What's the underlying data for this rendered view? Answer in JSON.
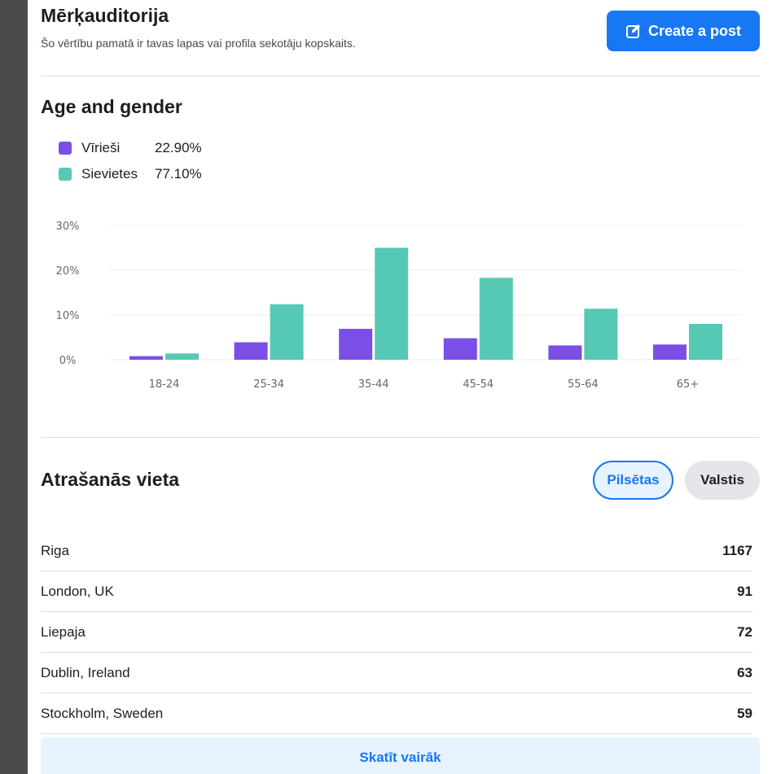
{
  "header": {
    "title": "Mērķauditorija",
    "subtitle": "Šo vērtību pamatā ir tavas lapas vai profila sekotāju kopskaits.",
    "create_label": "Create a post",
    "create_icon": "edit-icon"
  },
  "age_gender": {
    "title": "Age and gender",
    "legend": [
      {
        "name": "Vīrieši",
        "value": "22.90%",
        "color": "#7b4fe6"
      },
      {
        "name": "Sievietes",
        "value": "77.10%",
        "color": "#56c9b5"
      }
    ]
  },
  "chart_data": {
    "type": "bar",
    "categories": [
      "18-24",
      "25-34",
      "35-44",
      "45-54",
      "55-64",
      "65+"
    ],
    "series": [
      {
        "name": "Vīrieši",
        "values": [
          0.8,
          3.9,
          6.9,
          4.8,
          3.2,
          3.4
        ],
        "color": "#7b4fe6"
      },
      {
        "name": "Sievietes",
        "values": [
          1.4,
          12.4,
          25.0,
          18.3,
          11.4,
          8.0
        ],
        "color": "#56c9b5"
      }
    ],
    "y_ticks": [
      "0%",
      "10%",
      "20%",
      "30%"
    ],
    "ylim": [
      0,
      30
    ],
    "grid": true
  },
  "location": {
    "title": "Atrašanās vieta",
    "tabs": [
      {
        "label": "Pilsētas",
        "active": true
      },
      {
        "label": "Valstis",
        "active": false
      }
    ],
    "rows": [
      {
        "name": "Riga",
        "count": "1167"
      },
      {
        "name": "London, UK",
        "count": "91"
      },
      {
        "name": "Liepaja",
        "count": "72"
      },
      {
        "name": "Dublin, Ireland",
        "count": "63"
      },
      {
        "name": "Stockholm, Sweden",
        "count": "59"
      }
    ],
    "more_label": "Skatīt vairāk"
  }
}
